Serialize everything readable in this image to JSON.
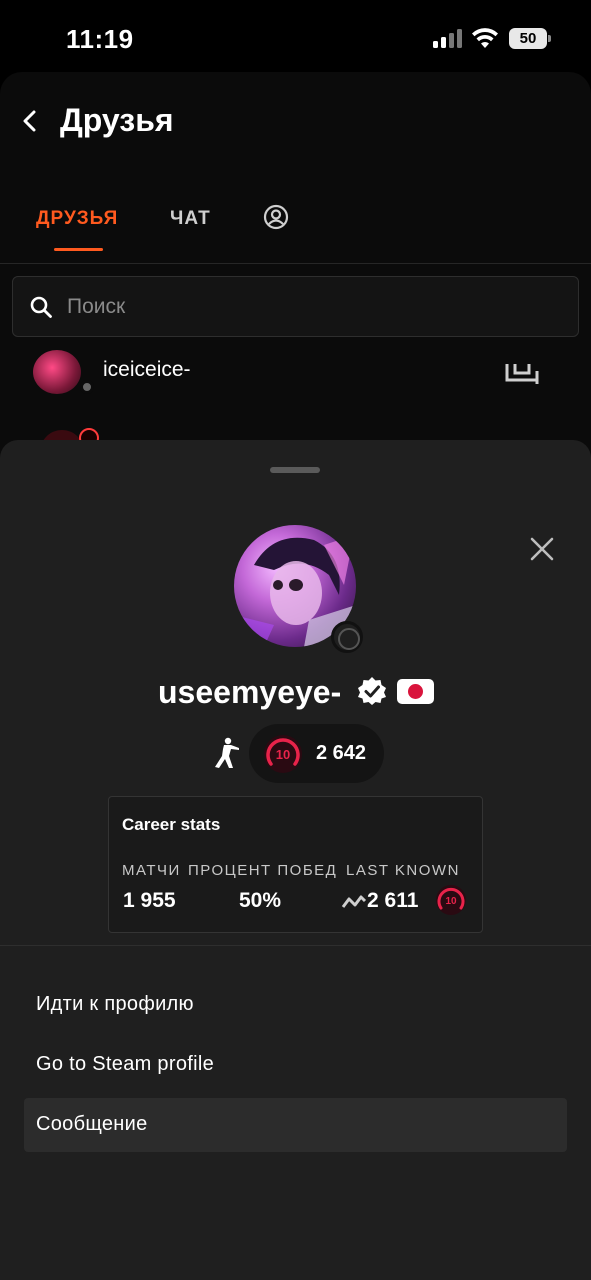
{
  "status_bar": {
    "time": "11:19",
    "battery_level": "50"
  },
  "header": {
    "title": "Друзья"
  },
  "tabs": [
    {
      "label": "ДРУЗЬЯ",
      "active": true
    },
    {
      "label": "ЧАТ",
      "active": false
    },
    {
      "icon": "profile-icon",
      "active": false
    }
  ],
  "search": {
    "placeholder": "Поиск",
    "value": ""
  },
  "friends": [
    {
      "name": "iceiceice-",
      "status": "offline"
    }
  ],
  "profile_sheet": {
    "username": "useemyeye-",
    "verified": true,
    "country_flag": "japan-flag-icon",
    "game_icon": "cs-player-icon",
    "level": "10",
    "elo": "2 642",
    "career": {
      "title": "Career stats",
      "matches_label": "МАТЧИ",
      "matches_value": "1 955",
      "winrate_label": "ПРОЦЕНТ ПОБЕД",
      "winrate_value": "50%",
      "last_known_label": "LAST KNOWN",
      "last_known_value": "2 611",
      "last_known_level": "10"
    },
    "actions": [
      {
        "label": "Идти к профилю"
      },
      {
        "label": "Go to Steam profile"
      },
      {
        "label": "Сообщение"
      }
    ]
  },
  "colors": {
    "accent": "#ff5a1f",
    "level_red": "#e8234a",
    "sheet_bg": "#1f1f1f"
  }
}
